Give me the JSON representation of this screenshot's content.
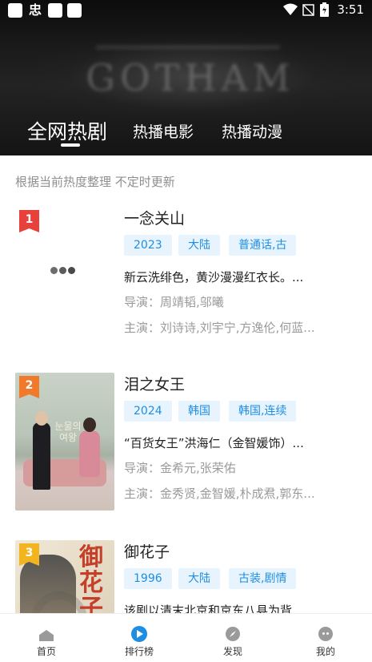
{
  "status_bar": {
    "time": "3:51",
    "left_glyph": "忠"
  },
  "header": {
    "background_text": "GOTHAM",
    "tabs": [
      {
        "label": "全网热剧",
        "active": true
      },
      {
        "label": "热播电影",
        "active": false
      },
      {
        "label": "热播动漫",
        "active": false
      }
    ]
  },
  "content": {
    "subtitle": "根据当前热度整理 不定时更新",
    "items": [
      {
        "rank": "1",
        "title": "一念关山",
        "tags": [
          "2023",
          "大陆",
          "普通话,古"
        ],
        "description": "新云洗绯色，黄沙漫漫红衣长。...",
        "director": "导演：周靖韬,邬曦",
        "cast": "主演：刘诗诗,刘宇宁,方逸伦,何蓝...",
        "poster": "loading"
      },
      {
        "rank": "2",
        "title": "泪之女王",
        "tags": [
          "2024",
          "韩国",
          "韩国,连续"
        ],
        "description": "“百货女王”洪海仁（金智媛饰）...",
        "director": "导演：金希元,张荣佑",
        "cast": "主演：金秀贤,金智媛,朴成焄,郭东...",
        "poster": "image",
        "poster_text": "눈물의 여왕"
      },
      {
        "rank": "3",
        "title": "御花子",
        "tags": [
          "1996",
          "大陆",
          "古装,剧情"
        ],
        "description": "该剧以清末北京和京东八县为背...",
        "director": "",
        "cast": "",
        "poster": "image",
        "poster_text": "御花子"
      }
    ]
  },
  "bottom_nav": {
    "items": [
      {
        "label": "首页",
        "icon": "home-icon",
        "active": false
      },
      {
        "label": "排行榜",
        "icon": "rank-icon",
        "active": true
      },
      {
        "label": "发现",
        "icon": "discover-icon",
        "active": false
      },
      {
        "label": "我的",
        "icon": "profile-icon",
        "active": false
      }
    ]
  },
  "colors": {
    "accent": "#1e8ee2",
    "tag_background": "#e8f4fd",
    "rank_1": "#e8403a",
    "rank_2": "#f07a2a",
    "rank_3": "#f3b51f"
  }
}
